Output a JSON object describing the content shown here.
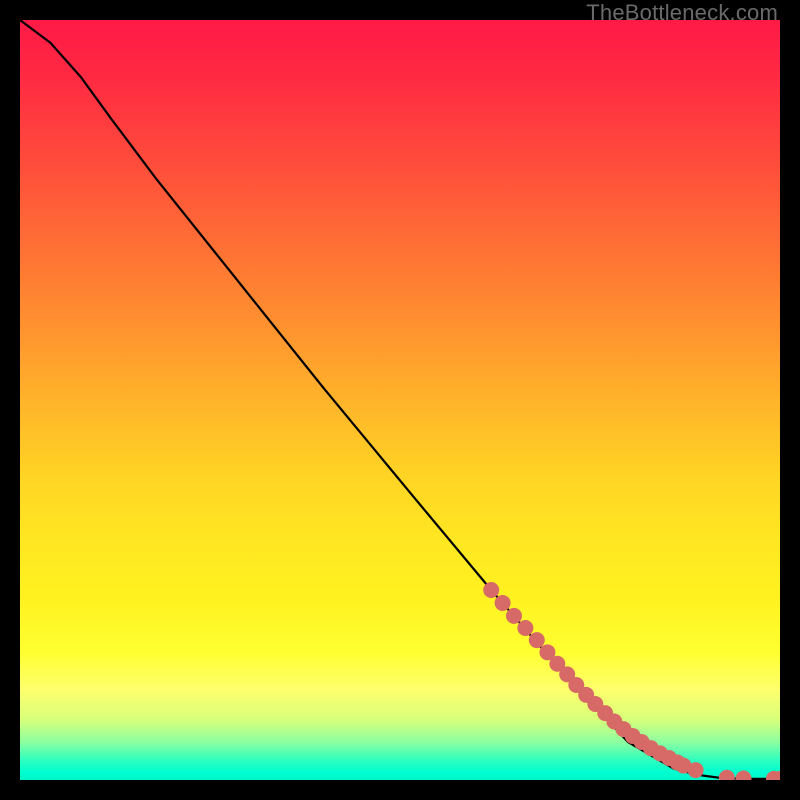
{
  "watermark": "TheBottleneck.com",
  "chart_data": {
    "type": "line",
    "title": "",
    "xlabel": "",
    "ylabel": "",
    "xlim": [
      0,
      100
    ],
    "ylim": [
      0,
      100
    ],
    "grid": false,
    "legend": false,
    "series": [
      {
        "name": "curve",
        "x": [
          0,
          4,
          8,
          12,
          18,
          28,
          40,
          52,
          62,
          72,
          80,
          86,
          89,
          92,
          95,
          100
        ],
        "y": [
          100,
          97,
          92.5,
          87,
          79,
          66.5,
          51.5,
          37,
          25,
          13.5,
          5,
          1.5,
          0.7,
          0.3,
          0.15,
          0.15
        ]
      }
    ],
    "points": {
      "name": "markers",
      "x": [
        62,
        63.5,
        65,
        66.5,
        68,
        69.4,
        70.7,
        72,
        73.2,
        74.5,
        75.7,
        77,
        78.2,
        79.4,
        80.6,
        81.8,
        83,
        84.2,
        85.4,
        86.5,
        87.3,
        88.9,
        93,
        95.2,
        99.2,
        100
      ],
      "y": [
        25.0,
        23.3,
        21.6,
        20.0,
        18.4,
        16.8,
        15.3,
        13.9,
        12.5,
        11.2,
        10.0,
        8.8,
        7.7,
        6.7,
        5.8,
        5.0,
        4.2,
        3.5,
        2.9,
        2.3,
        1.9,
        1.3,
        0.3,
        0.2,
        0.15,
        0.15
      ]
    },
    "point_style": {
      "color": "#d76a66",
      "radius_pct": 1.05
    }
  }
}
